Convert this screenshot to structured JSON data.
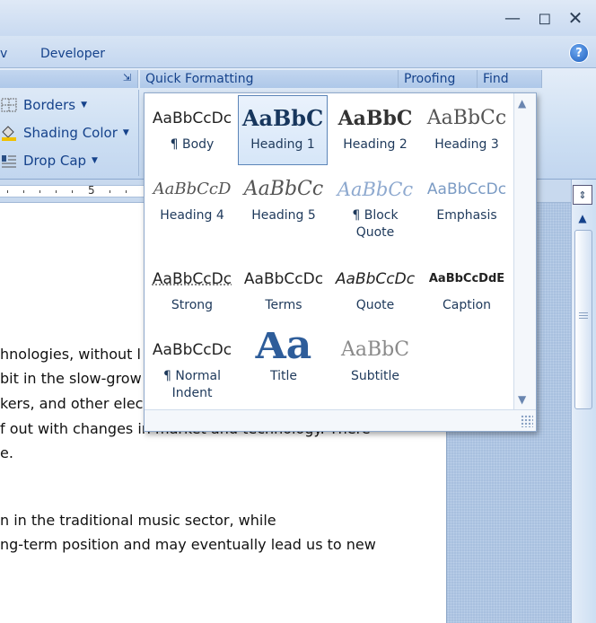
{
  "window": {
    "min_icon": "minimize-icon",
    "max_icon": "maximize-icon",
    "close_icon": "close-icon"
  },
  "tabs": {
    "partial": "v",
    "developer": "Developer",
    "help": "?"
  },
  "ribbon": {
    "groups": {
      "quick_formatting": "Quick Formatting",
      "proofing": "Proofing",
      "find": "Find"
    },
    "items": {
      "borders": "Borders",
      "shading_color": "Shading Color",
      "drop_cap": "Drop Cap"
    }
  },
  "ruler": {
    "mark": "5"
  },
  "gallery": {
    "styles": [
      {
        "sample": "AaBbCcDc",
        "name": "¶ Body"
      },
      {
        "sample": "AaBbC",
        "name": "Heading 1"
      },
      {
        "sample": "AaBbC",
        "name": "Heading 2"
      },
      {
        "sample": "AaBbCc",
        "name": "Heading 3"
      },
      {
        "sample": "AaBbCcD",
        "name": "Heading 4"
      },
      {
        "sample": "AaBbCc",
        "name": "Heading 5"
      },
      {
        "sample": "AaBbCc",
        "name": "¶ Block",
        "name2": "Quote"
      },
      {
        "sample": "AaBbCcDc",
        "name": "Emphasis"
      },
      {
        "sample": "AaBbCcDc",
        "name": "Strong"
      },
      {
        "sample": "AaBbCcDc",
        "name": "Terms"
      },
      {
        "sample": "AaBbCcDc",
        "name": "Quote"
      },
      {
        "sample": "AaBbCcDdE",
        "name": "Caption"
      },
      {
        "sample": "AaBbCcDc",
        "name": "¶ Normal",
        "name2": "Indent"
      },
      {
        "sample": "Aa",
        "name": "Title"
      },
      {
        "sample": "AaBbC",
        "name": "Subtitle"
      }
    ]
  },
  "document": {
    "lines": [
      "hnologies, without l",
      " bit in the slow-grow",
      "kers, and other elec",
      "f out with changes in market and technology. There",
      "e.",
      "n in the traditional music sector, while",
      "ng-term position and may eventually lead us to new"
    ]
  }
}
